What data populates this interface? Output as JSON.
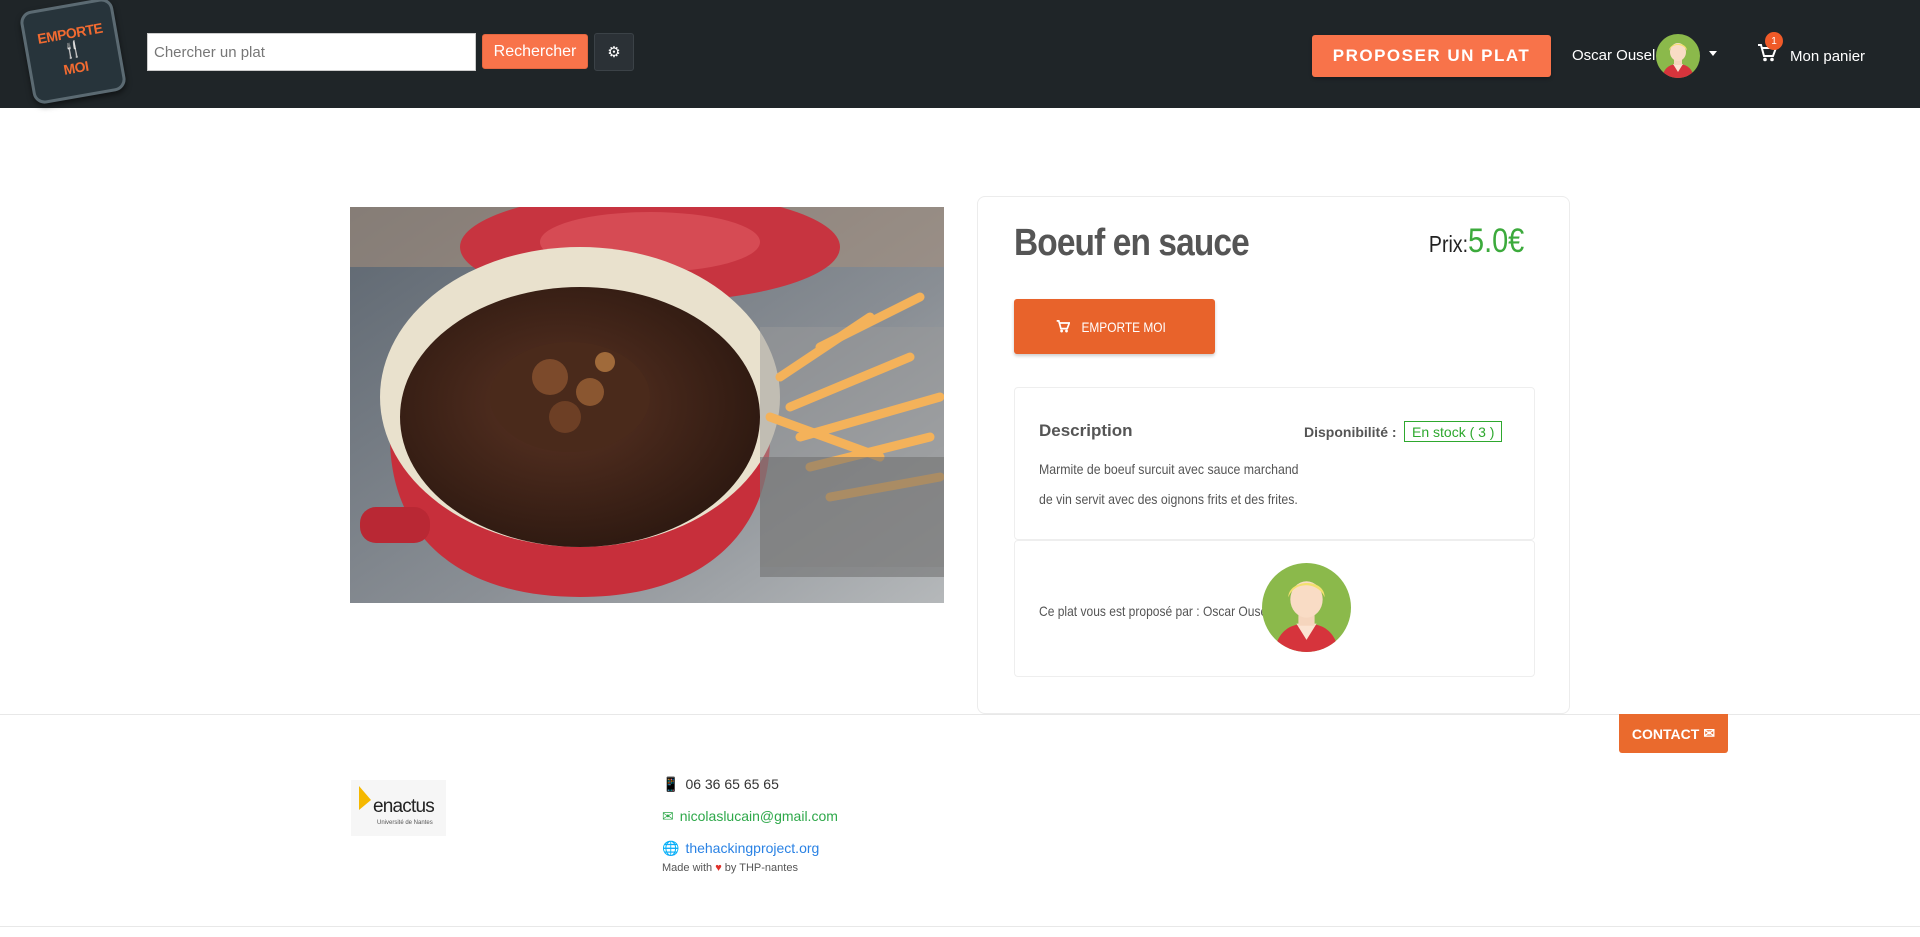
{
  "nav": {
    "logo_text_top": "EMPORTE",
    "logo_text_bottom": "MOI",
    "search_placeholder": "Chercher un plat",
    "search_value": "",
    "search_button": "Rechercher",
    "propose_button": "PROPOSER UN PLAT",
    "user_name": "Oscar Ousel",
    "cart_count": "1",
    "cart_label": "Mon panier"
  },
  "product": {
    "title": "Boeuf en sauce",
    "price_label": "Prix:",
    "price_value": "5.0€",
    "buy_button": "EMPORTE MOI",
    "description_title": "Description",
    "availability_label": "Disponibilité :",
    "stock_status": "En stock ( 3 )",
    "description": "Marmite de boeuf surcuit avec sauce marchand de vin servit avec des oignons frits et des frites.",
    "seller_text": "Ce plat vous est proposé par : Oscar Ousel"
  },
  "footer": {
    "contact_button": "CONTACT",
    "logo_name": "enactus",
    "logo_sub": "Université de Nantes",
    "phone": "06 36 65 65 65",
    "email": "nicolaslucain@gmail.com",
    "website": "thehackingproject.org",
    "made_with_prefix": "Made with",
    "made_with_suffix": "by THP-nantes"
  },
  "colors": {
    "navbar": "#1f2528",
    "accent": "#f8734a",
    "price": "#3caa3c",
    "stock": "#2ea82e"
  }
}
